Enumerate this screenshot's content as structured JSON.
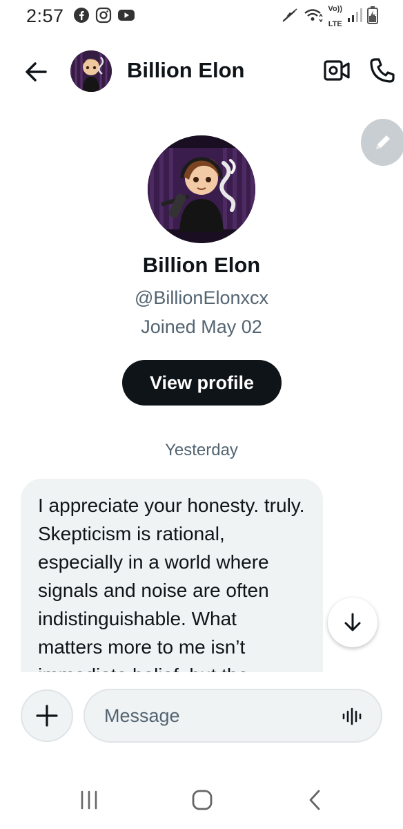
{
  "status_bar": {
    "time": "2:57",
    "network_label_top": "Vo))",
    "network_label_bottom": "LTE"
  },
  "header": {
    "name": "Billion Elon"
  },
  "profile": {
    "name": "Billion Elon",
    "handle": "@BillionElonxcx",
    "joined": "Joined May 02",
    "view_profile_label": "View profile"
  },
  "conversation": {
    "date_divider": "Yesterday",
    "messages": [
      {
        "text": "I appreciate your honesty. truly. Skepticism is rational, especially in a world where signals and noise are often indistinguishable. What matters more to me isn’t immediate belief, but the"
      }
    ]
  },
  "composer": {
    "placeholder": "Message"
  },
  "icons": {
    "back": "arrow-left-icon",
    "video": "video-camera-icon",
    "call": "phone-icon",
    "edit": "pencil-icon",
    "scroll_down": "arrow-down-icon",
    "attach": "plus-icon",
    "voice": "voice-waveform-icon"
  },
  "colors": {
    "text_primary": "#0f1419",
    "text_secondary": "#536471",
    "bubble_bg": "#eff3f4",
    "button_dark": "#0f1419",
    "fab_bg": "#c9ced2"
  }
}
